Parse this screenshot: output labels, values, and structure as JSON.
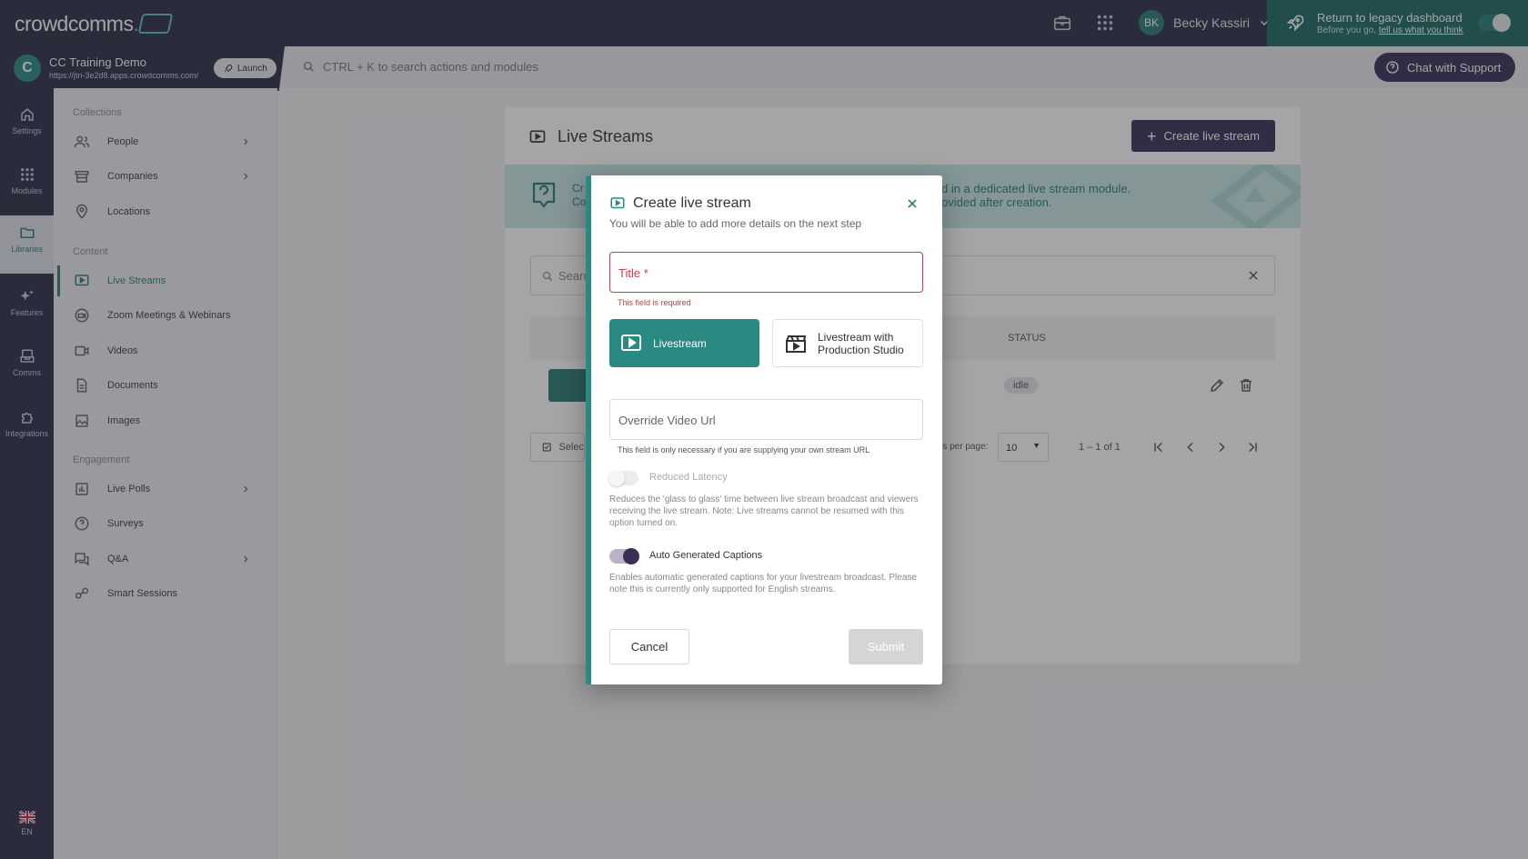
{
  "app": {
    "brand": "crowdcomms",
    "brand_suffix": "."
  },
  "user": {
    "initials": "BK",
    "name": "Becky Kassiri"
  },
  "legacy": {
    "title": "Return to legacy dashboard",
    "subtitle_prefix": "Before you go,",
    "subtitle_link": "tell us what you think"
  },
  "event": {
    "name": "CC Training Demo",
    "url": "https://jtn-3e2d8.apps.crowdcomms.com/",
    "launch_label": "Launch"
  },
  "search": {
    "placeholder": "CTRL + K to search actions and modules"
  },
  "support": {
    "label": "Chat with Support"
  },
  "rail": [
    {
      "label": "Settings",
      "icon": "home-icon"
    },
    {
      "label": "Modules",
      "icon": "grid-icon"
    },
    {
      "label": "Libraries",
      "icon": "folder-icon"
    },
    {
      "label": "Features",
      "icon": "sparkle-icon"
    },
    {
      "label": "Comms",
      "icon": "inbox-icon"
    },
    {
      "label": "Integrations",
      "icon": "puzzle-icon"
    }
  ],
  "lang": {
    "code": "EN"
  },
  "sidebar": {
    "sections": [
      {
        "title": "Collections"
      },
      {
        "title": "Content"
      },
      {
        "title": "Engagement"
      }
    ],
    "items": [
      {
        "label": "People",
        "icon": "people-icon"
      },
      {
        "label": "Companies",
        "icon": "building-icon"
      },
      {
        "label": "Locations",
        "icon": "pin-icon"
      },
      {
        "label": "Live Streams",
        "icon": "play-screen-icon"
      },
      {
        "label": "Zoom Meetings & Webinars",
        "icon": "camera-circle-icon"
      },
      {
        "label": "Videos",
        "icon": "video-icon"
      },
      {
        "label": "Documents",
        "icon": "document-icon"
      },
      {
        "label": "Images",
        "icon": "image-icon"
      },
      {
        "label": "Live Polls",
        "icon": "poll-icon"
      },
      {
        "label": "Surveys",
        "icon": "question-icon"
      },
      {
        "label": "Q&A",
        "icon": "chat-icon"
      },
      {
        "label": "Smart Sessions",
        "icon": "sessions-icon"
      }
    ]
  },
  "main": {
    "title": "Live Streams",
    "create_label": "Create live stream",
    "banner_left": "Cr\nCo",
    "banner_right_1": "d in a dedicated live stream module.",
    "banner_right_2": "ovided after creation.",
    "search_placeholder": "Searc",
    "status_header": "STATUS",
    "row_status": "idle",
    "select_label": "Selec",
    "per_page_label": "ms per page:",
    "per_page_value": "10",
    "range": "1 – 1 of 1"
  },
  "modal": {
    "title": "Create live stream",
    "subtitle": "You will be able to add more details on the next step",
    "title_field_label": "Title *",
    "title_error": "This field is required",
    "option_livestream": "Livestream",
    "option_studio": "Livestream with Production Studio",
    "url_placeholder": "Override Video Url",
    "url_hint": "This field is only necessary if you are supplying your own stream URL",
    "reduced_latency_label": "Reduced Latency",
    "reduced_latency_desc": "Reduces the 'glass to glass' time between live stream broadcast and viewers receiving the live stream. Note: Live streams cannot be resumed with this option turned on.",
    "captions_label": "Auto Generated Captions",
    "captions_desc": "Enables automatic generated captions for your livestream broadcast. Please note this is currently only supported for English streams.",
    "cancel_label": "Cancel",
    "submit_label": "Submit"
  },
  "colors": {
    "accent": "#2a8a82",
    "primary": "#3a2f55",
    "error": "#d63a47",
    "nav": "#2b2e45"
  }
}
